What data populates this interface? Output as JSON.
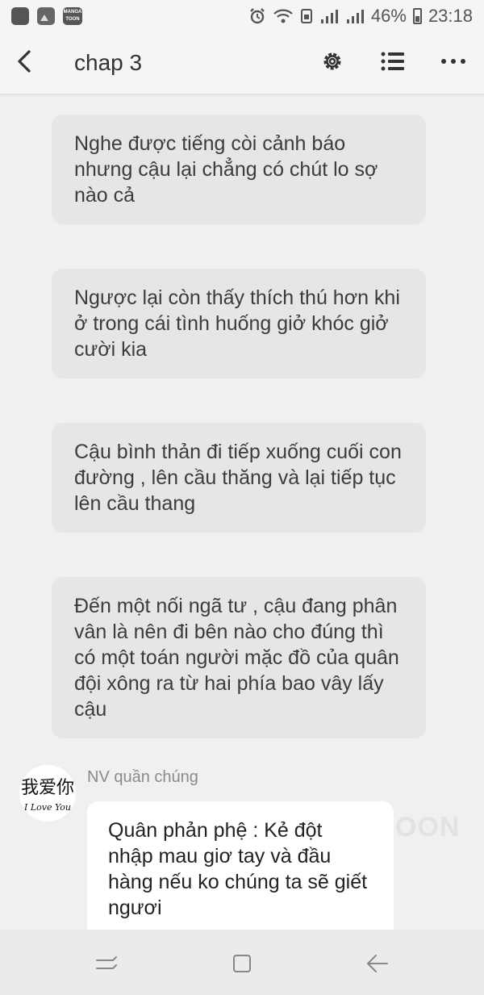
{
  "status_bar": {
    "battery": "46%",
    "time": "23:18",
    "icons": [
      "app-square-icon",
      "gallery-icon",
      "mangatoon-icon",
      "alarm-icon",
      "wifi-icon",
      "signal-icon",
      "signal-icon-2",
      "battery-icon"
    ],
    "manga_icon_text": "MANGA TOON"
  },
  "app_bar": {
    "title": "chap 3",
    "icons": [
      "back-arrow-icon",
      "settings-gear-icon",
      "chapter-list-icon",
      "more-options-icon"
    ]
  },
  "messages": [
    {
      "text": "Nghe được tiếng còi cảnh báo nhưng cậu lại chẳng có chút lo sợ nào cả"
    },
    {
      "text": "Ngược lại còn thấy thích thú hơn khi ở trong cái tình huống giở khóc giở cười kia"
    },
    {
      "text": "Cậu bình thản đi tiếp xuống cuối con đường , lên cầu thăng và lại tiếp tục lên cầu thang"
    },
    {
      "text": "Đến một nối ngã tư , cậu đang phân vân là nên đi bên nào cho đúng thì có một toán người mặc đồ của quân đội xông ra từ hai phía bao vây lấy cậu"
    }
  ],
  "character": {
    "name": "NV quần chúng",
    "avatar_text_cn": "我爱你",
    "avatar_text_en": "I Love You",
    "message": "Quân phản phệ :  Kẻ đột nhập mau giơ tay và đầu hàng nếu ko chúng ta sẽ giết ngươi"
  },
  "watermark": "OON",
  "nav_bar": {
    "icons": [
      "recent-apps-icon",
      "home-icon",
      "back-icon"
    ]
  },
  "colors": {
    "background": "#f0f0f0",
    "narration_bubble": "#e6e6e6",
    "dialog_bubble": "#ffffff"
  }
}
